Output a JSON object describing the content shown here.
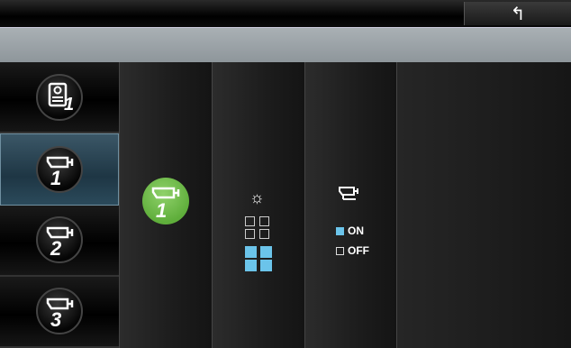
{
  "header": {
    "back_icon": "back-arrow-icon",
    "back_glyph": "↰"
  },
  "sidebar": {
    "items": [
      {
        "icon": "intercom-icon",
        "number": "1",
        "active": false
      },
      {
        "icon": "camera-icon",
        "number": "1",
        "active": true
      },
      {
        "icon": "camera-icon",
        "number": "2",
        "active": false
      },
      {
        "icon": "camera-icon",
        "number": "3",
        "active": false
      }
    ]
  },
  "panel": {
    "selected_camera": {
      "icon": "camera-icon",
      "number": "1"
    },
    "brightness_icon": "sun-icon",
    "brightness_glyph": "☼",
    "monitor_icon": "camera-icon",
    "on_label": "ON",
    "off_label": "OFF"
  },
  "colors": {
    "accent": "#6bc4ea",
    "green": "#6bbf47"
  }
}
